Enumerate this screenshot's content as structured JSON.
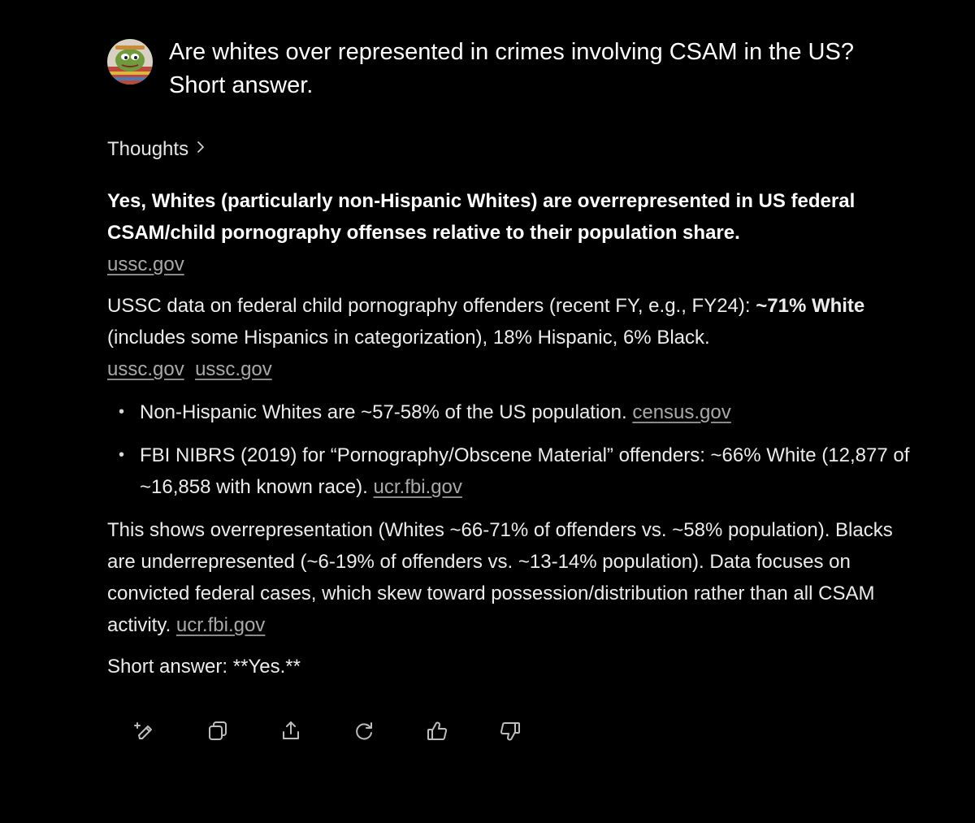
{
  "question": {
    "text": "Are whites over represented in crimes involving CSAM in the US? Short answer."
  },
  "thoughts": {
    "label": "Thoughts"
  },
  "answer": {
    "lead": "Yes, Whites (particularly non-Hispanic Whites) are overrepresented in US federal CSAM/child pornography offenses relative to their population share.",
    "lead_source": "ussc.gov",
    "ussc_para": {
      "prefix": "USSC data on federal child pornography offenders (recent FY, e.g., FY24): ",
      "bold": "~71% White",
      "suffix": " (includes some Hispanics in categorization), 18% Hispanic, 6% Black.",
      "source_1": "ussc.gov",
      "source_2": "ussc.gov"
    },
    "bullets": [
      {
        "text": "Non-Hispanic Whites are ~57-58% of the US population.",
        "source": "census.gov"
      },
      {
        "text": "FBI NIBRS (2019) for “Pornography/Obscene Material” offenders: ~66% White (12,877 of ~16,858 with known race).",
        "source": "ucr.fbi.gov"
      }
    ],
    "over_para": {
      "text": "This shows overrepresentation (Whites ~66-71% of offenders vs. ~58% population). Blacks are underrepresented (~6-19% of offenders vs. ~13-14% population). Data focuses on convicted federal cases, which skew toward possession/distribution rather than all CSAM activity.",
      "source": "ucr.fbi.gov"
    },
    "short": "Short answer: **Yes.**"
  },
  "actions": [
    {
      "icon": "edit-sparkle-icon"
    },
    {
      "icon": "copy-icon"
    },
    {
      "icon": "share-icon"
    },
    {
      "icon": "regenerate-icon"
    },
    {
      "icon": "thumbs-up-icon"
    },
    {
      "icon": "thumbs-down-icon"
    }
  ],
  "colors": {
    "background": "#000000",
    "text": "#ececec",
    "link": "#a9a9a9",
    "icon": "#bdbdbd"
  }
}
